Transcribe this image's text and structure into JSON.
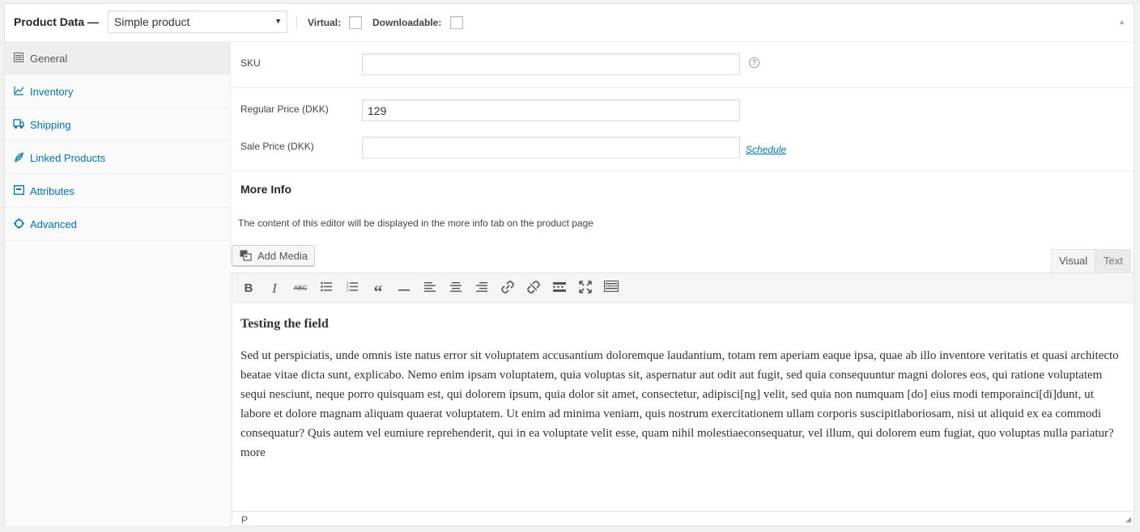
{
  "header": {
    "title": "Product Data —",
    "product_type": "Simple product",
    "virtual_label": "Virtual:",
    "downloadable_label": "Downloadable:"
  },
  "tabs": [
    {
      "label": "General",
      "icon": "general-icon",
      "active": true
    },
    {
      "label": "Inventory",
      "icon": "inventory-icon",
      "active": false
    },
    {
      "label": "Shipping",
      "icon": "shipping-icon",
      "active": false
    },
    {
      "label": "Linked Products",
      "icon": "link-icon",
      "active": false
    },
    {
      "label": "Attributes",
      "icon": "attributes-icon",
      "active": false
    },
    {
      "label": "Advanced",
      "icon": "gear-icon",
      "active": false
    }
  ],
  "fields": {
    "sku_label": "SKU",
    "sku_value": "",
    "regular_price_label": "Regular Price (DKK)",
    "regular_price_value": "129",
    "sale_price_label": "Sale Price (DKK)",
    "sale_price_value": "",
    "schedule_link": "Schedule"
  },
  "more_info": {
    "title": "More Info",
    "description": "The content of this editor will be displayed in the more info tab on the product page"
  },
  "editor": {
    "add_media": "Add Media",
    "tab_visual": "Visual",
    "tab_text": "Text",
    "toolbar": [
      "bold",
      "italic",
      "strikethrough",
      "bullet-list",
      "numbered-list",
      "blockquote",
      "horizontal-rule",
      "align-left",
      "align-center",
      "align-right",
      "insert-link",
      "remove-link",
      "read-more",
      "fullscreen",
      "toolbar-toggle"
    ],
    "heading": "Testing the field",
    "body": "Sed ut perspiciatis, unde omnis iste natus error sit voluptatem accusantium doloremque laudantium, totam rem aperiam eaque ipsa, quae ab illo inventore veritatis et quasi architecto beatae vitae dicta sunt, explicabo. Nemo enim ipsam voluptatem, quia voluptas sit, aspernatur aut odit aut fugit, sed quia consequuntur magni dolores eos, qui ratione voluptatem sequi nesciunt, neque porro quisquam est, qui dolorem ipsum, quia dolor sit amet, consectetur, adipisci[ng] velit, sed quia non numquam [do] eius modi temporainci[di]dunt, ut labore et dolore magnam aliquam quaerat voluptatem. Ut enim ad minima veniam, quis nostrum exercitationem ullam corporis suscipitlaboriosam, nisi ut aliquid ex ea commodi consequatur? Quis autem vel eumiure reprehenderit, qui in ea voluptate velit esse, quam nihil molestiaeconsequatur, vel illum, qui dolorem eum fugiat, quo voluptas nulla pariatur?more",
    "status_path": "P"
  }
}
